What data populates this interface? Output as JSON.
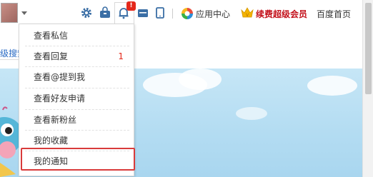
{
  "topbar": {
    "app_center": "应用中心",
    "vip_label": "续费超级会员",
    "baidu_home": "百度首页",
    "notification_badge": "!"
  },
  "menu": {
    "items": [
      {
        "label": "查看私信",
        "count": ""
      },
      {
        "label": "查看回复",
        "count": "1"
      },
      {
        "label": "查看@提到我",
        "count": ""
      },
      {
        "label": "查看好友申请",
        "count": ""
      },
      {
        "label": "查看新粉丝",
        "count": ""
      },
      {
        "label": "我的收藏",
        "count": ""
      },
      {
        "label": "我的通知",
        "count": ""
      }
    ]
  },
  "page": {
    "partial_link": "级搜索"
  },
  "colors": {
    "accent_red": "#e4281b",
    "highlight_red": "#d93b3b",
    "link_blue": "#2a6bc4",
    "content_blue": "#b3dcf2"
  },
  "icons": [
    "settings-icon",
    "bag-icon",
    "bell-icon",
    "store-icon",
    "tablet-icon",
    "app-center-icon",
    "vip-crown-icon"
  ]
}
